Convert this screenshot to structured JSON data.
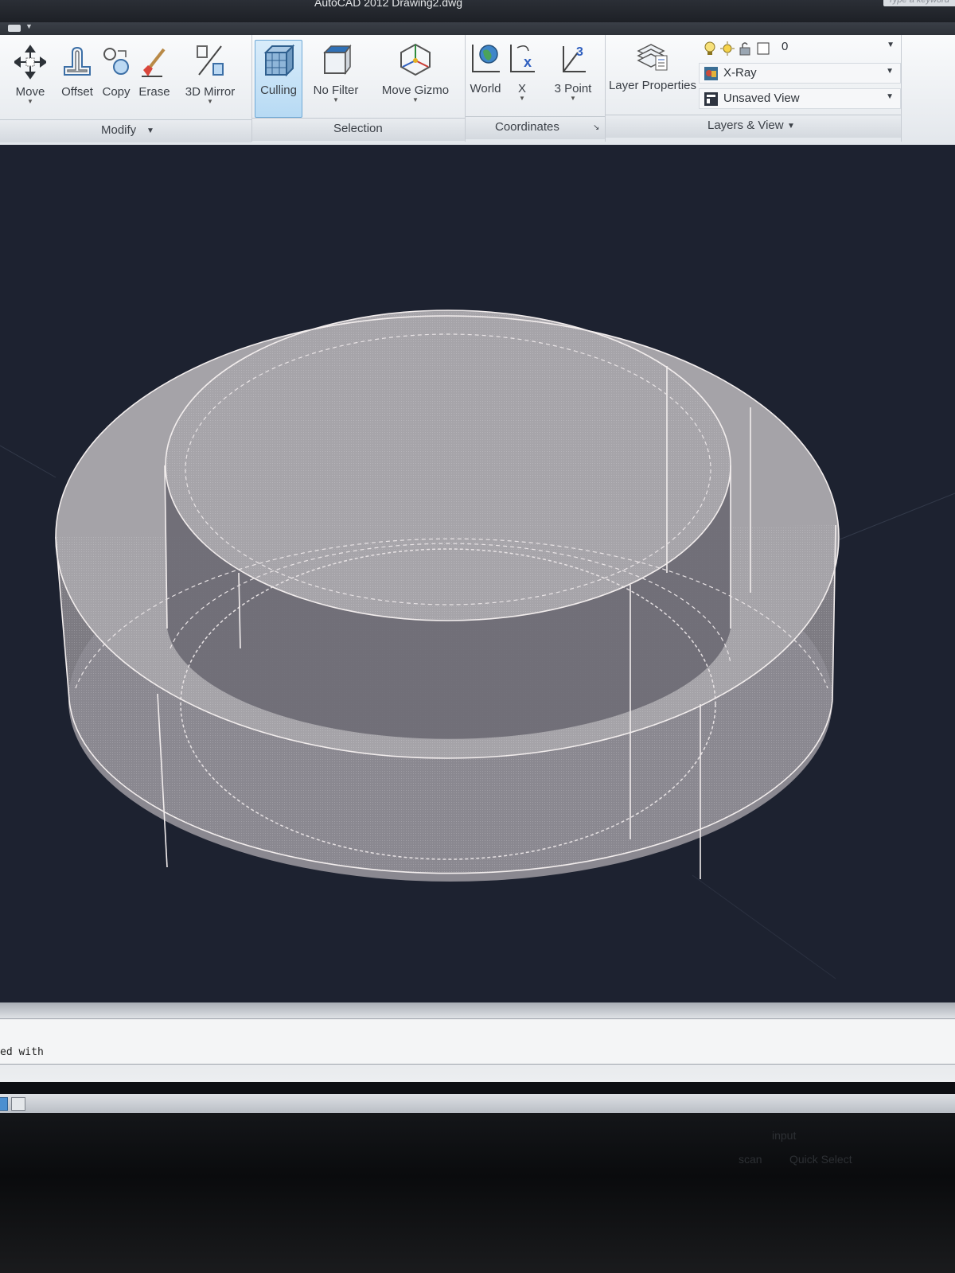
{
  "window": {
    "title": "AutoCAD 2012   Drawing2.dwg",
    "search_placeholder": "Type a keyword"
  },
  "ribbon": {
    "modify": {
      "panel_label": "Modify",
      "tools": {
        "move": "Move",
        "offset": "Offset",
        "copy": "Copy",
        "erase": "Erase",
        "mirror3d": "3D Mirror"
      }
    },
    "selection": {
      "panel_label": "Selection",
      "tools": {
        "culling": "Culling",
        "no_filter": "No Filter",
        "move_gizmo": "Move Gizmo"
      }
    },
    "coordinates": {
      "panel_label": "Coordinates",
      "tools": {
        "world": "World",
        "x": "X",
        "three_point": "3 Point"
      }
    },
    "layers_view": {
      "panel_label": "Layers & View",
      "layer_properties": "Layer Properties",
      "current_layer": "0",
      "visual_style": "X-Ray",
      "named_view": "Unsaved View"
    }
  },
  "command_line": {
    "text": "ed with"
  },
  "bezel_ghost": {
    "input": "input",
    "quick_select": "Quick Select",
    "scan": "scan"
  },
  "colors": {
    "viewport_bg": "#1d2230",
    "selected_tool_bg": "#b7daf4",
    "ribbon_bg": "#eef1f4"
  }
}
